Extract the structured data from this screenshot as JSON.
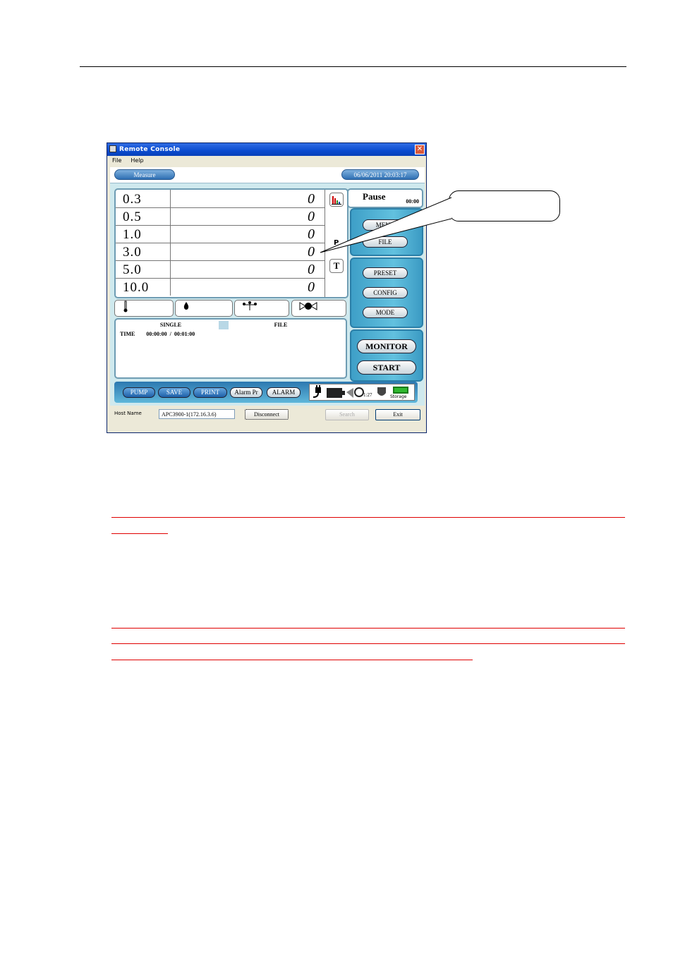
{
  "window": {
    "title": "Remote Console",
    "menu": [
      "File",
      "Help"
    ]
  },
  "header": {
    "tab_label": "Measure",
    "datetime": "06/06/2011 20:03:17"
  },
  "readings": [
    {
      "size": "0.3",
      "count": "0"
    },
    {
      "size": "0.5",
      "count": "0"
    },
    {
      "size": "1.0",
      "count": "0"
    },
    {
      "size": "3.0",
      "count": "0"
    },
    {
      "size": "5.0",
      "count": "0"
    },
    {
      "size": "10.0",
      "count": "0"
    }
  ],
  "side_column": {
    "mode_letter": "P",
    "t_button": "T"
  },
  "status_panel": {
    "state": "Pause",
    "timer": "00:00"
  },
  "right_buttons": {
    "menu": "MENU",
    "file": "FILE",
    "preset": "PRESET",
    "config": "CONFIG",
    "mode": "MODE",
    "monitor": "MONITOR",
    "start": "START"
  },
  "sensor_icons": [
    "thermometer-icon",
    "drop-icon",
    "wind-icon",
    "valve-icon"
  ],
  "log": {
    "tab_single": "SINGLE",
    "tab_file": "FILE",
    "time_label": "TIME",
    "time_value": "00:00:00  /  00:01:00"
  },
  "bottom_buttons": {
    "pump": "PUMP",
    "save": "SAVE",
    "print": "PRINT",
    "alarm_pr": "Alarm Pr",
    "alarm": "ALARM"
  },
  "status_icons": {
    "counter": "1:27",
    "storage_label": "Storage"
  },
  "host": {
    "label": "Host Name",
    "value": "APC3900-1(172.16.3.6)",
    "disconnect": "Disconnect",
    "search": "Search",
    "exit": "Exit"
  },
  "colors": {
    "title_bar": "#0A4BCF",
    "panel_blue": "#4EAED3",
    "annotation_red": "#E00000"
  }
}
